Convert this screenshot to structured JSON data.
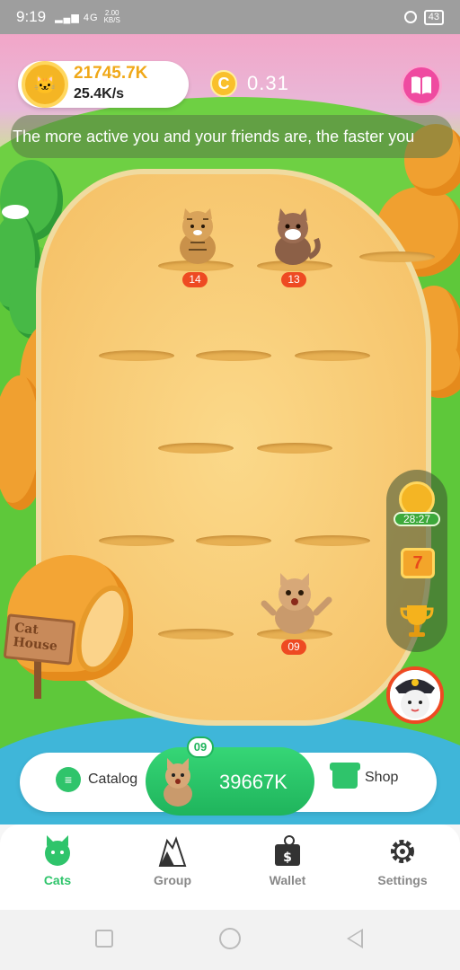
{
  "status_bar": {
    "time": "9:19",
    "signal": "4G",
    "speed_value": "2.00",
    "speed_unit": "KB/S",
    "battery": "43"
  },
  "header": {
    "coin_total": "21745.7K",
    "coin_rate": "25.4K/s",
    "cash_value": "0.31",
    "ticker": "The more active you and your friends are, the faster you"
  },
  "cats": [
    {
      "level": "14"
    },
    {
      "level": "13"
    },
    {
      "level": "09"
    }
  ],
  "side_panel": {
    "timer": "28:27"
  },
  "house": {
    "sign": "Cat House"
  },
  "action_bar": {
    "catalog_label": "Catalog",
    "buy_level": "09",
    "buy_price": "39667K",
    "shop_label": "Shop"
  },
  "nav": {
    "items": [
      {
        "label": "Cats",
        "icon": "cat-face-icon",
        "active": true
      },
      {
        "label": "Group",
        "icon": "cat-group-icon",
        "active": false
      },
      {
        "label": "Wallet",
        "icon": "wallet-icon",
        "active": false
      },
      {
        "label": "Settings",
        "icon": "gear-icon",
        "active": false
      }
    ]
  },
  "colors": {
    "accent_green": "#2fc46b",
    "coin_gold": "#f0a818",
    "level_badge": "#ee4a22",
    "book_pink": "#ef4aa0"
  }
}
